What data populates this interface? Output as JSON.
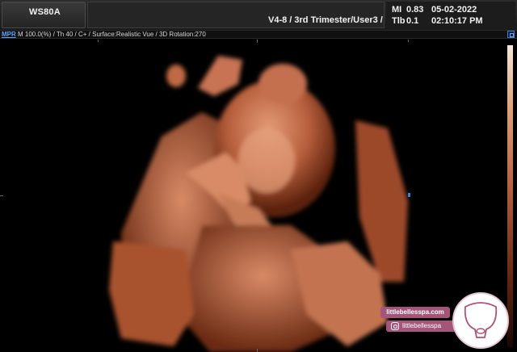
{
  "header": {
    "brand": "WS80A",
    "probe_info": "V4-8 / 3rd Trimester/User3 /",
    "mi_label": "MI",
    "mi_value": "0.83",
    "tib_label": "Tlb",
    "tib_value": "0.1",
    "date": "05-02-2022",
    "time": "02:10:17 PM"
  },
  "status_bar": {
    "mode_button": "MPR",
    "params": "M 100.0(%) / Th 40 / C+ / Surface:Realistic Vue / 3D Rotation:270"
  },
  "watermark": {
    "website": "littlebellesspa.com",
    "instagram": "littlebellesspa",
    "logo": "uterus-outline-logo"
  },
  "colors": {
    "accent_blue": "#3f7fd0",
    "skin_light": "#e39a76",
    "skin_dark": "#6b2a12",
    "watermark_pink": "#a3567a"
  }
}
